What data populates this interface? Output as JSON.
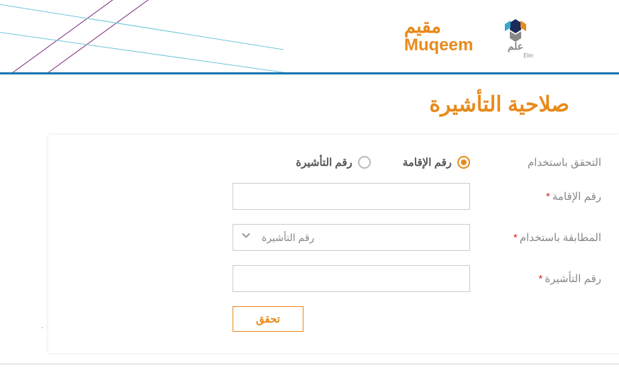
{
  "header": {
    "brand_ar": "مقيم",
    "brand_en": "Muqeem",
    "elm_label": "Elm"
  },
  "page": {
    "title": "صلاحية التأشيرة"
  },
  "form": {
    "verify_by_label": "التحقق باستخدام",
    "radio_iqama": "رقم الإقامة",
    "radio_visa": "رقم التأشيرة",
    "iqama_label": "رقم الإقامة",
    "match_by_label": "المطابقة باستخدام",
    "match_select_placeholder": "رقم التأشيرة",
    "visa_number_label": "رقم التأشيرة",
    "submit_label": "تحقق",
    "required_mark": "*"
  }
}
